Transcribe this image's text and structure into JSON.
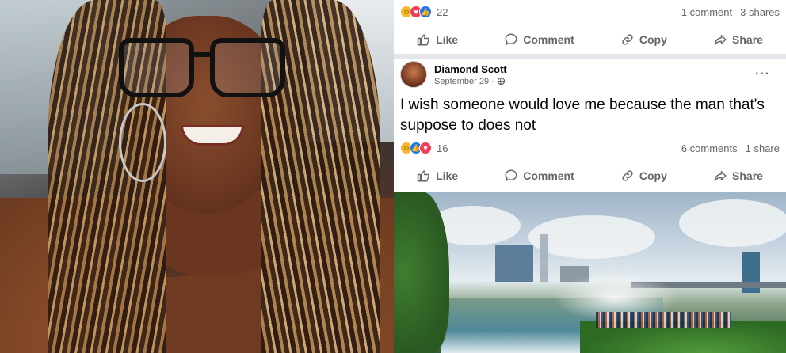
{
  "top_post": {
    "reaction_count": "22",
    "comments": "1 comment",
    "shares": "3 shares"
  },
  "actions": {
    "like": "Like",
    "comment": "Comment",
    "copy": "Copy",
    "share": "Share"
  },
  "post": {
    "author": "Diamond Scott",
    "date": "September 29 ·",
    "text": "I wish someone would love me because the man that's suppose to does not",
    "reaction_count": "16",
    "comments": "6 comments",
    "shares": "1 share",
    "more": "···"
  },
  "icons": {
    "reactions": [
      "haha-icon",
      "like-icon",
      "love-icon"
    ],
    "privacy": "globe-icon"
  },
  "colors": {
    "fb_blue": "#1877f2",
    "love_red": "#f33e58",
    "haha_yellow": "#f7b928",
    "muted": "#65676b"
  }
}
